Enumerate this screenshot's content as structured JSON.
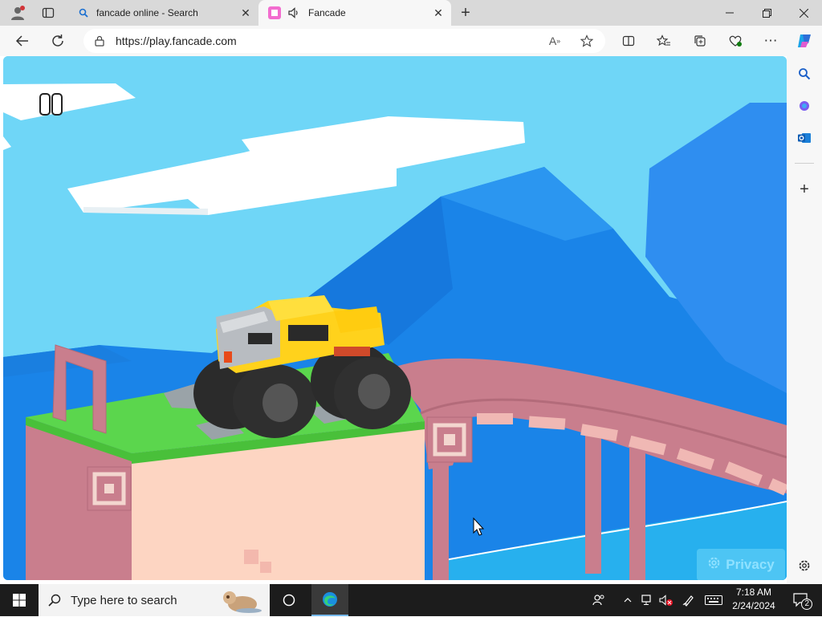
{
  "browser": {
    "tabs": [
      {
        "title": "fancade online - Search",
        "active": false
      },
      {
        "title": "Fancade",
        "active": true
      }
    ],
    "address": {
      "url": "https://play.fancade.com"
    }
  },
  "game": {
    "privacy_label": "Privacy"
  },
  "taskbar": {
    "search_placeholder": "Type here to search",
    "time": "7:18 AM",
    "date": "2/24/2024",
    "notification_count": "2"
  },
  "colors": {
    "sky": "#6fd6f7",
    "mountain": "#1a84e8",
    "bridge": "#c97e8d",
    "grass": "#5bd64d",
    "truck": "#ffd21c"
  }
}
